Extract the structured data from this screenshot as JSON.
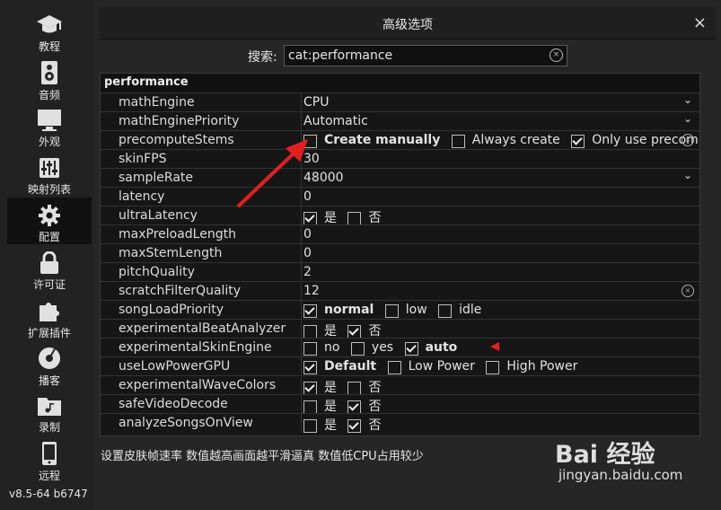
{
  "sidebar": {
    "items": [
      {
        "label": "教程",
        "icon": "graduation-cap-icon"
      },
      {
        "label": "音频",
        "icon": "speaker-icon"
      },
      {
        "label": "外观",
        "icon": "monitor-icon"
      },
      {
        "label": "映射列表",
        "icon": "sliders-icon"
      },
      {
        "label": "配置",
        "icon": "gear-icon"
      },
      {
        "label": "许可证",
        "icon": "lock-icon"
      },
      {
        "label": "扩展插件",
        "icon": "puzzle-icon"
      },
      {
        "label": "播客",
        "icon": "podcast-icon"
      },
      {
        "label": "录制",
        "icon": "folder-music-icon"
      },
      {
        "label": "远程",
        "icon": "phone-icon"
      }
    ],
    "active": "配置",
    "version": "v8.5-64 b6747"
  },
  "dialog": {
    "title": "高级选项",
    "close": "×"
  },
  "search": {
    "label": "搜索:",
    "value": "cat:performance",
    "clear": "×"
  },
  "table": {
    "section": "performance",
    "rows": [
      {
        "key": "mathEngine",
        "value": "CPU"
      },
      {
        "key": "mathEnginePriority",
        "value": "Automatic"
      },
      {
        "key": "precomputeStems",
        "options": [
          "Create manually",
          "Always create",
          "Only use precompute"
        ]
      },
      {
        "key": "skinFPS",
        "value": "30"
      },
      {
        "key": "sampleRate",
        "value": "48000"
      },
      {
        "key": "latency",
        "value": "0"
      },
      {
        "key": "ultraLatency",
        "options": [
          "是",
          "否"
        ]
      },
      {
        "key": "maxPreloadLength",
        "value": "0"
      },
      {
        "key": "maxStemLength",
        "value": "0"
      },
      {
        "key": "pitchQuality",
        "value": "2"
      },
      {
        "key": "scratchFilterQuality",
        "value": "12"
      },
      {
        "key": "songLoadPriority",
        "options": [
          "normal",
          "low",
          "idle"
        ]
      },
      {
        "key": "experimentalBeatAnalyzer",
        "options": [
          "是",
          "否"
        ]
      },
      {
        "key": "experimentalSkinEngine",
        "options": [
          "no",
          "yes",
          "auto"
        ]
      },
      {
        "key": "useLowPowerGPU",
        "options": [
          "Default",
          "Low Power",
          "High Power"
        ]
      },
      {
        "key": "experimentalWaveColors",
        "options": [
          "是",
          "否"
        ]
      },
      {
        "key": "safeVideoDecode",
        "options": [
          "是",
          "否"
        ]
      },
      {
        "key": "analyzeSongsOnView",
        "options": [
          "是",
          "否"
        ]
      }
    ]
  },
  "hint": "设置皮肤帧速率  数值越高画面越平滑逼真  数值低CPU占用较少",
  "watermark": {
    "brand": "Bai 经验",
    "url": "jingyan.baidu.com"
  },
  "colors": {
    "annotation": "#e02020",
    "background": "#262626"
  }
}
